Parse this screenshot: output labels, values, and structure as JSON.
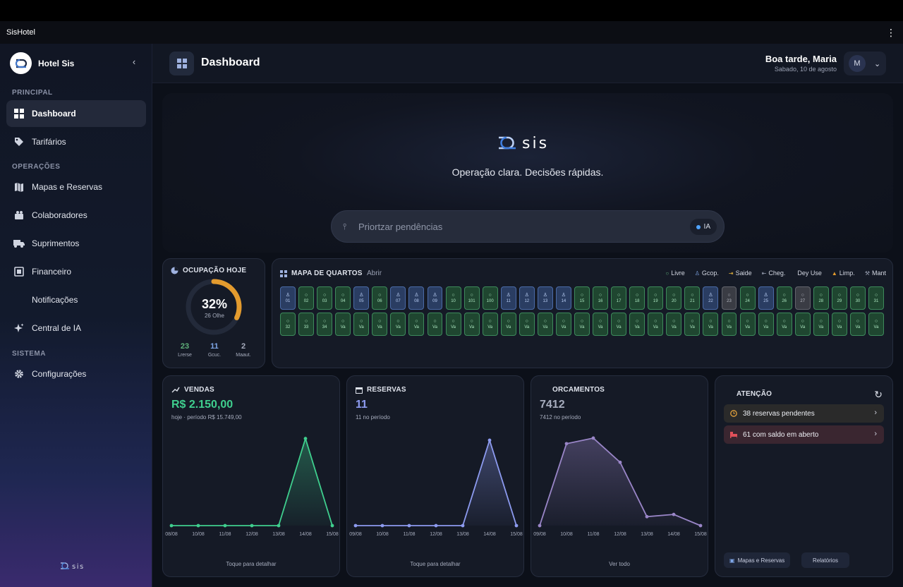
{
  "window": {
    "title": "SisHotel"
  },
  "sidebar": {
    "brand": "Hotel Sis",
    "sections": {
      "principal": "PRINCIPAL",
      "operacoes": "OPERAÇÕES",
      "sistema": "SISTEMA"
    },
    "items": [
      {
        "label": "Dashboard",
        "icon": "grid-icon"
      },
      {
        "label": "Tarifários",
        "icon": "tag-icon"
      },
      {
        "label": "Mapas e Reservas",
        "icon": "map-icon"
      },
      {
        "label": "Colaboradores",
        "icon": "users-icon"
      },
      {
        "label": "Suprimentos",
        "icon": "truck-icon"
      },
      {
        "label": "Financeiro",
        "icon": "finance-icon"
      },
      {
        "label": "Notificações",
        "icon": ""
      },
      {
        "label": "Central de IA",
        "icon": "sparkle-icon"
      },
      {
        "label": "Configurações",
        "icon": "gear-icon"
      }
    ],
    "footer_logo": "sis"
  },
  "header": {
    "title": "Dashboard",
    "greeting": "Boa tarde, Maria",
    "date": "Sabado, 10 de agosto",
    "avatar_initial": "M"
  },
  "hero": {
    "wordmark": "sis",
    "tagline": "Operação clara. Decisões rápidas.",
    "search_placeholder": "Priortzar pendências",
    "ia_label": "IA"
  },
  "occupancy": {
    "title": "OCUPAÇÃO HOJE",
    "percent_label": "32%",
    "percent": 0.32,
    "sub": "26 Olhe",
    "stats": [
      {
        "value": "23",
        "label": "Lrerse",
        "color": "#5fb07a"
      },
      {
        "value": "11",
        "label": "Gcuc.",
        "color": "#7fa7e8"
      },
      {
        "value": "2",
        "label": "Maaut.",
        "color": "#a6acbd"
      }
    ],
    "accent": "#e39b2e"
  },
  "room_map": {
    "title": "MAPA DE QUARTOS",
    "open_link": "Abrir",
    "legend": [
      {
        "label": "Livre",
        "mark": "○",
        "color": "#5fb07a"
      },
      {
        "label": "Gcop.",
        "mark": "♙",
        "color": "#7fa7e8"
      },
      {
        "label": "Saide",
        "mark": "⇥",
        "color": "#e3b23c"
      },
      {
        "label": "Cheg.",
        "mark": "⇤",
        "color": "#9aa1b3"
      },
      {
        "label": "Dey Use",
        "mark": "",
        "color": "#9aa1b3"
      },
      {
        "label": "Limp.",
        "mark": "▲",
        "color": "#e39b2e"
      },
      {
        "label": "Mant",
        "mark": "⚒",
        "color": "#9aa1b3"
      }
    ],
    "row1": [
      {
        "n": "01",
        "s": "ocup"
      },
      {
        "n": "02",
        "s": "livre"
      },
      {
        "n": "03",
        "s": "livre"
      },
      {
        "n": "04",
        "s": "livre"
      },
      {
        "n": "05",
        "s": "ocup"
      },
      {
        "n": "06",
        "s": "livre"
      },
      {
        "n": "07",
        "s": "ocup"
      },
      {
        "n": "08",
        "s": "ocup"
      },
      {
        "n": "09",
        "s": "ocup"
      },
      {
        "n": "10",
        "s": "livre"
      },
      {
        "n": "101",
        "s": "livre"
      },
      {
        "n": "100",
        "s": "livre"
      },
      {
        "n": "11",
        "s": "ocup"
      },
      {
        "n": "12",
        "s": "ocup"
      },
      {
        "n": "13",
        "s": "ocup"
      },
      {
        "n": "14",
        "s": "ocup"
      },
      {
        "n": "15",
        "s": "livre"
      },
      {
        "n": "16",
        "s": "livre"
      },
      {
        "n": "17",
        "s": "livre"
      },
      {
        "n": "18",
        "s": "livre"
      },
      {
        "n": "19",
        "s": "livre"
      },
      {
        "n": "20",
        "s": "livre"
      },
      {
        "n": "21",
        "s": "livre"
      },
      {
        "n": "22",
        "s": "ocup"
      },
      {
        "n": "23",
        "s": "manut"
      },
      {
        "n": "24",
        "s": "livre"
      },
      {
        "n": "25",
        "s": "ocup"
      },
      {
        "n": "26",
        "s": "livre"
      },
      {
        "n": "27",
        "s": "manut"
      },
      {
        "n": "28",
        "s": "livre"
      },
      {
        "n": "29",
        "s": "livre"
      },
      {
        "n": "30",
        "s": "livre"
      },
      {
        "n": "31",
        "s": "livre"
      }
    ],
    "row2": [
      {
        "n": "32",
        "s": "livre"
      },
      {
        "n": "33",
        "s": "livre"
      },
      {
        "n": "34",
        "s": "livre"
      },
      {
        "n": "Va",
        "s": "livre"
      },
      {
        "n": "Va",
        "s": "livre"
      },
      {
        "n": "Va",
        "s": "livre"
      },
      {
        "n": "Va",
        "s": "livre"
      },
      {
        "n": "Va",
        "s": "livre"
      },
      {
        "n": "Va",
        "s": "livre"
      },
      {
        "n": "Va",
        "s": "livre"
      },
      {
        "n": "Va",
        "s": "livre"
      },
      {
        "n": "Va",
        "s": "livre"
      },
      {
        "n": "Va",
        "s": "livre"
      },
      {
        "n": "Va",
        "s": "livre"
      },
      {
        "n": "Va",
        "s": "livre"
      },
      {
        "n": "Va",
        "s": "livre"
      },
      {
        "n": "Va",
        "s": "livre"
      },
      {
        "n": "Va",
        "s": "livre"
      },
      {
        "n": "Va",
        "s": "livre"
      },
      {
        "n": "Va",
        "s": "livre"
      },
      {
        "n": "Va",
        "s": "livre"
      },
      {
        "n": "Va",
        "s": "livre"
      },
      {
        "n": "Va",
        "s": "livre"
      },
      {
        "n": "Va",
        "s": "livre"
      },
      {
        "n": "Va",
        "s": "livre"
      },
      {
        "n": "Va",
        "s": "livre"
      },
      {
        "n": "Va",
        "s": "livre"
      },
      {
        "n": "Va",
        "s": "livre"
      },
      {
        "n": "Va",
        "s": "livre"
      },
      {
        "n": "Va",
        "s": "livre"
      },
      {
        "n": "Va",
        "s": "livre"
      },
      {
        "n": "Va",
        "s": "livre"
      },
      {
        "n": "Va",
        "s": "livre"
      }
    ]
  },
  "vendas": {
    "title": "VENDAS",
    "value": "R$ 2.150,00",
    "sub": "hoje · período R$ 15.749,00",
    "footer": "Toque para detalhar",
    "color": "#3fcf8e"
  },
  "reservas": {
    "title": "RESERVAS",
    "value": "11",
    "sub": "11 no período",
    "footer": "Toque para detalhar",
    "color": "#8d9bf0"
  },
  "orcamentos": {
    "title": "ORCAMENTOS",
    "value": "7412",
    "sub": "7412 no período",
    "footer": "Ver todo",
    "color": "#9a86c8"
  },
  "chart_data": [
    {
      "type": "area",
      "title": "VENDAS",
      "x": [
        "08/08",
        "10/08",
        "11/08",
        "12/08",
        "13/08",
        "14/08",
        "15/08"
      ],
      "values": [
        0,
        0,
        0,
        0,
        0,
        2150,
        0
      ],
      "ylim": [
        0,
        2300
      ]
    },
    {
      "type": "area",
      "title": "RESERVAS",
      "x": [
        "09/08",
        "10/08",
        "11/08",
        "12/08",
        "13/08",
        "14/08",
        "15/08"
      ],
      "values": [
        0,
        0,
        0,
        0,
        0,
        11,
        0
      ],
      "ylim": [
        0,
        12
      ]
    },
    {
      "type": "area",
      "title": "ORCAMENTOS",
      "x": [
        "09/08",
        "10/08",
        "11/08",
        "12/08",
        "13/08",
        "14/08",
        "15/08"
      ],
      "values": [
        0,
        2200,
        2350,
        1700,
        240,
        300,
        0
      ],
      "ylim": [
        0,
        2500
      ]
    }
  ],
  "attention": {
    "title": "ATENÇÃO",
    "alerts": [
      {
        "text": "38 reservas pendentes",
        "color": "#e3a23c"
      },
      {
        "text": "61 com saldo em aberto",
        "color": "#e0505a"
      }
    ],
    "buttons": [
      "Mapas e Reservas",
      "Relatórios"
    ]
  }
}
